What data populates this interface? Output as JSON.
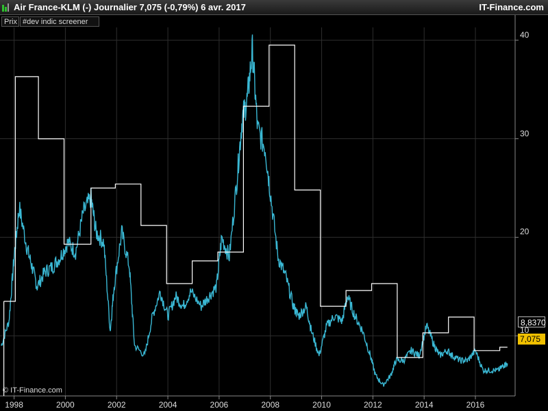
{
  "header": {
    "title": "Air France-KLM (-)   Journalier   7,075 (-0,79%)   6 avr. 2017",
    "brand": "IT-Finance.com"
  },
  "tabs": [
    {
      "label": "Prix"
    },
    {
      "label": "#dev indic screener"
    }
  ],
  "flags": {
    "prev_value": "8,8370",
    "last_value": "7,075",
    "last_color": "#f0c000"
  },
  "copyright": "© IT-Finance.com",
  "colors": {
    "price": "#3ab8d4",
    "step": "#ffffff",
    "grid": "#2e2e2e",
    "axis": "#888888"
  },
  "chart_data": {
    "type": "line",
    "title": "",
    "xlabel": "",
    "ylabel": "",
    "y_ticks": [
      10,
      20,
      30,
      40
    ],
    "x_ticks": [
      "1998",
      "2000",
      "2002",
      "2004",
      "2006",
      "2008",
      "2010",
      "2012",
      "2014",
      "2016"
    ],
    "xlim": [
      1997.45,
      2017.55
    ],
    "ylim": [
      3.9,
      41.3
    ],
    "grid": true,
    "series": [
      {
        "style": "price",
        "points": [
          [
            1997.5,
            9.0
          ],
          [
            1997.8,
            11.5
          ],
          [
            1998.0,
            18.0
          ],
          [
            1998.2,
            23.0
          ],
          [
            1998.5,
            19.0
          ],
          [
            1998.7,
            17.0
          ],
          [
            1998.9,
            15.0
          ],
          [
            1999.2,
            16.5
          ],
          [
            1999.5,
            17.0
          ],
          [
            1999.8,
            18.0
          ],
          [
            2000.1,
            19.5
          ],
          [
            2000.4,
            18.5
          ],
          [
            2000.7,
            22.5
          ],
          [
            2001.0,
            24.0
          ],
          [
            2001.2,
            20.5
          ],
          [
            2001.5,
            19.5
          ],
          [
            2001.75,
            10.5
          ],
          [
            2001.9,
            15.0
          ],
          [
            2002.2,
            20.5
          ],
          [
            2002.5,
            17.0
          ],
          [
            2002.7,
            9.0
          ],
          [
            2003.1,
            8.0
          ],
          [
            2003.4,
            12.0
          ],
          [
            2003.7,
            14.5
          ],
          [
            2004.0,
            12.0
          ],
          [
            2004.3,
            14.0
          ],
          [
            2004.6,
            13.0
          ],
          [
            2004.9,
            14.5
          ],
          [
            2005.3,
            13.0
          ],
          [
            2005.6,
            14.0
          ],
          [
            2005.9,
            15.0
          ],
          [
            2006.1,
            20.0
          ],
          [
            2006.4,
            18.0
          ],
          [
            2006.7,
            26.0
          ],
          [
            2006.9,
            32.0
          ],
          [
            2007.1,
            34.0
          ],
          [
            2007.3,
            39.0
          ],
          [
            2007.5,
            31.0
          ],
          [
            2007.8,
            29.0
          ],
          [
            2008.0,
            24.5
          ],
          [
            2008.3,
            18.0
          ],
          [
            2008.6,
            16.0
          ],
          [
            2008.9,
            13.0
          ],
          [
            2009.1,
            12.0
          ],
          [
            2009.4,
            13.0
          ],
          [
            2009.6,
            10.5
          ],
          [
            2009.9,
            8.0
          ],
          [
            2010.2,
            11.0
          ],
          [
            2010.5,
            12.0
          ],
          [
            2010.8,
            11.5
          ],
          [
            2011.0,
            14.0
          ],
          [
            2011.3,
            12.0
          ],
          [
            2011.6,
            10.5
          ],
          [
            2011.9,
            8.0
          ],
          [
            2012.1,
            6.0
          ],
          [
            2012.4,
            5.0
          ],
          [
            2012.7,
            6.0
          ],
          [
            2012.9,
            7.5
          ],
          [
            2013.2,
            7.5
          ],
          [
            2013.5,
            8.5
          ],
          [
            2013.8,
            8.0
          ],
          [
            2014.1,
            11.0
          ],
          [
            2014.4,
            9.0
          ],
          [
            2014.6,
            8.0
          ],
          [
            2014.9,
            8.5
          ],
          [
            2015.1,
            8.0
          ],
          [
            2015.4,
            7.5
          ],
          [
            2015.7,
            7.5
          ],
          [
            2016.0,
            8.5
          ],
          [
            2016.3,
            6.5
          ],
          [
            2016.6,
            6.5
          ],
          [
            2016.9,
            6.5
          ],
          [
            2017.1,
            7.0
          ],
          [
            2017.25,
            7.2
          ]
        ]
      },
      {
        "style": "step",
        "points": [
          [
            1997.6,
            13.5
          ],
          [
            1998.05,
            13.5
          ],
          [
            1998.05,
            36.3
          ],
          [
            1998.95,
            36.3
          ],
          [
            1998.95,
            30.0
          ],
          [
            1999.95,
            30.0
          ],
          [
            1999.95,
            19.3
          ],
          [
            2001.0,
            19.3
          ],
          [
            2001.0,
            25.0
          ],
          [
            2001.95,
            25.0
          ],
          [
            2001.95,
            25.4
          ],
          [
            2002.95,
            25.4
          ],
          [
            2002.95,
            21.2
          ],
          [
            2003.95,
            21.2
          ],
          [
            2003.95,
            15.3
          ],
          [
            2004.95,
            15.3
          ],
          [
            2004.95,
            17.6
          ],
          [
            2005.95,
            17.6
          ],
          [
            2005.95,
            18.5
          ],
          [
            2006.95,
            18.5
          ],
          [
            2006.95,
            33.3
          ],
          [
            2007.95,
            33.3
          ],
          [
            2007.95,
            39.5
          ],
          [
            2008.95,
            39.5
          ],
          [
            2008.95,
            24.8
          ],
          [
            2009.95,
            24.8
          ],
          [
            2009.95,
            13.0
          ],
          [
            2010.95,
            13.0
          ],
          [
            2010.95,
            14.6
          ],
          [
            2011.95,
            14.6
          ],
          [
            2011.95,
            15.3
          ],
          [
            2012.95,
            15.3
          ],
          [
            2012.95,
            7.8
          ],
          [
            2013.95,
            7.8
          ],
          [
            2013.95,
            10.3
          ],
          [
            2014.95,
            10.3
          ],
          [
            2014.95,
            11.9
          ],
          [
            2015.95,
            11.9
          ],
          [
            2015.95,
            8.5
          ],
          [
            2016.95,
            8.5
          ],
          [
            2016.95,
            8.84
          ],
          [
            2017.25,
            8.84
          ]
        ]
      }
    ]
  }
}
